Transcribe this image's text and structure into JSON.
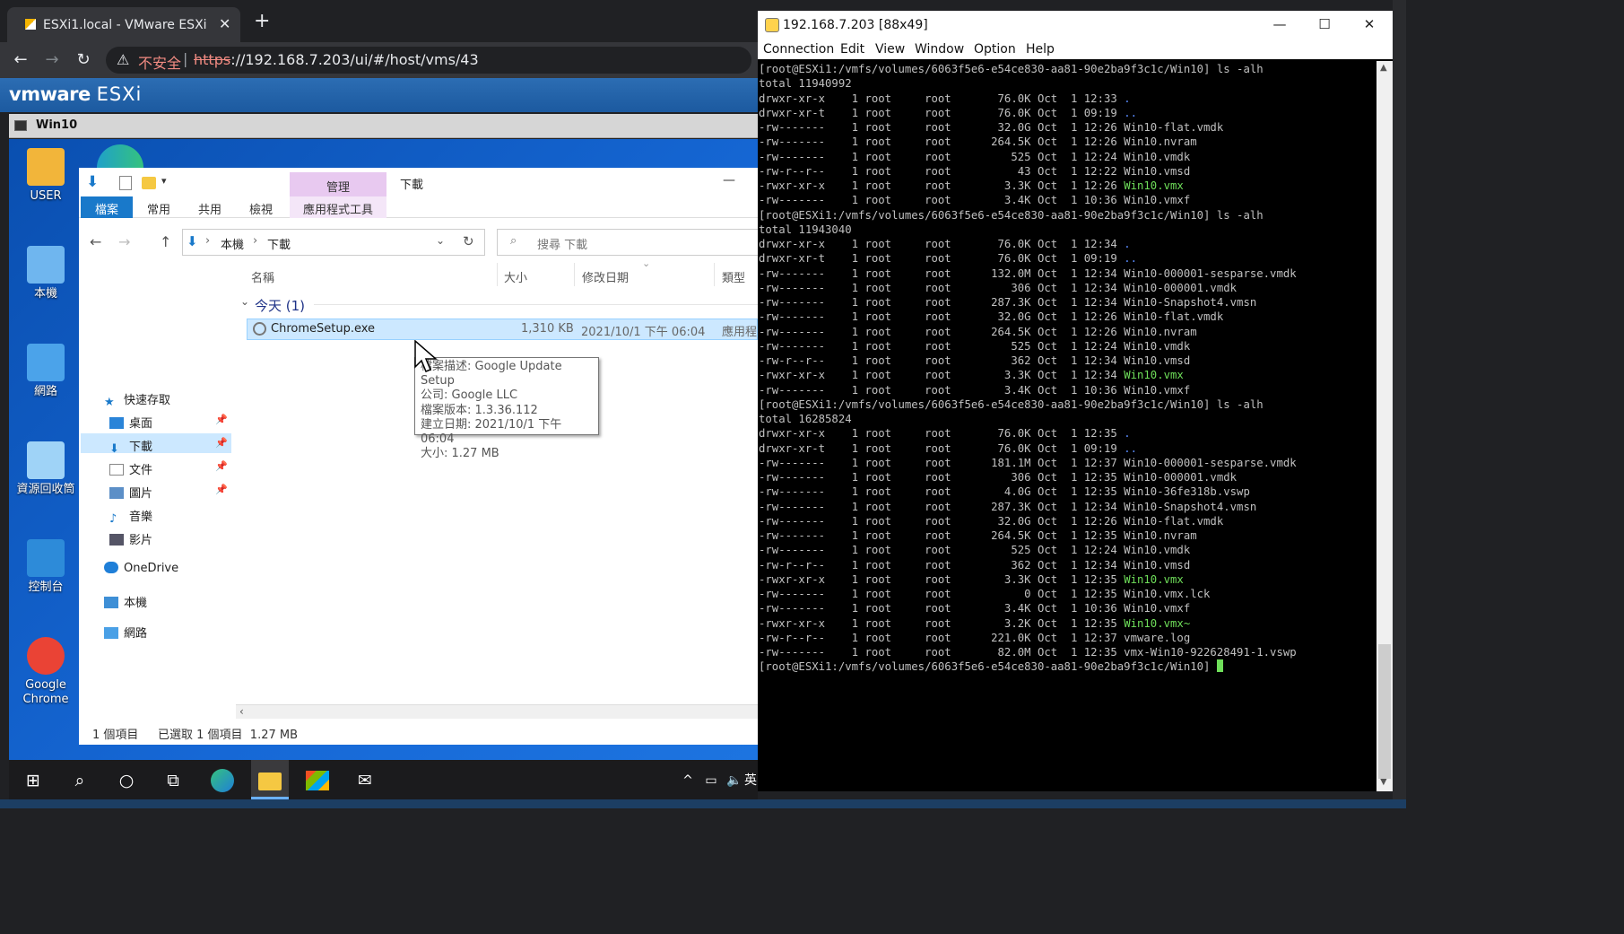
{
  "browser": {
    "tab_title": "ESXi1.local - VMware ESXi",
    "tab_close": "✕",
    "new_tab": "+",
    "insecure_label": "不安全",
    "url_scheme": "https",
    "url_rest": "://192.168.7.203/ui/#/host/vms/43"
  },
  "esxi": {
    "logo_vm": "vmware",
    "logo_product": "ESXi",
    "vm_name": "Win10"
  },
  "desktop": {
    "icons": [
      {
        "label": "USER",
        "color": "#f2b53a"
      },
      {
        "label": "本機",
        "color": "#6fb6ef"
      },
      {
        "label": "網路",
        "color": "#4ba3ea"
      },
      {
        "label": "資源回收筒",
        "color": "#9fd3f7"
      },
      {
        "label": "控制台",
        "color": "#2d8bd9"
      },
      {
        "label": "Google\nChrome",
        "color": "#ea4335"
      }
    ]
  },
  "explorer": {
    "window_title": "下載",
    "minimize": "—",
    "context_tab": "管理",
    "ribbon_tabs": [
      "檔案",
      "常用",
      "共用",
      "檢視"
    ],
    "context_sub": "應用程式工具",
    "breadcrumb": [
      "本機",
      "下載"
    ],
    "search_placeholder": "搜尋 下載",
    "columns": [
      "名稱",
      "大小",
      "修改日期",
      "類型"
    ],
    "nav": {
      "quick_access": "快速存取",
      "items": [
        "桌面",
        "下載",
        "文件",
        "圖片",
        "音樂",
        "影片"
      ],
      "onedrive": "OneDrive",
      "this_pc": "本機",
      "network": "網路"
    },
    "group_header": "今天 (1)",
    "file": {
      "name": "ChromeSetup.exe",
      "size": "1,310 KB",
      "modified": "2021/10/1 下午 06:04",
      "type": "應用程"
    },
    "tooltip": [
      "檔案描述: Google Update Setup",
      "公司: Google LLC",
      "檔案版本: 1.3.36.112",
      "建立日期: 2021/10/1 下午 06:04",
      "大小: 1.27 MB"
    ],
    "status_count": "1 個項目",
    "status_selected": "已選取 1 個項目  1.27 MB"
  },
  "taskbar": {
    "tray_text": "英"
  },
  "putty": {
    "title": "192.168.7.203 [88x49]",
    "menu": [
      "Connection",
      "Edit",
      "View",
      "Window",
      "Option",
      "Help"
    ]
  },
  "terminal_lines": [
    [
      [
        "[root@ESXi1:/vmfs/volumes/6063f5e6-e54ce830-aa81-90e2ba9f3c1c/Win10] ls -alh",
        ""
      ]
    ],
    [
      [
        "total 11940992",
        ""
      ]
    ],
    [
      [
        "drwxr-xr-x    1 root     root       76.0K Oct  1 12:33 ",
        ""
      ],
      [
        ".",
        "b"
      ]
    ],
    [
      [
        "drwxr-xr-t    1 root     root       76.0K Oct  1 09:19 ",
        ""
      ],
      [
        "..",
        "b"
      ]
    ],
    [
      [
        "-rw-------    1 root     root       32.0G Oct  1 12:26 Win10-flat.vmdk",
        ""
      ]
    ],
    [
      [
        "-rw-------    1 root     root      264.5K Oct  1 12:26 Win10.nvram",
        ""
      ]
    ],
    [
      [
        "-rw-------    1 root     root         525 Oct  1 12:24 Win10.vmdk",
        ""
      ]
    ],
    [
      [
        "-rw-r--r--    1 root     root          43 Oct  1 12:22 Win10.vmsd",
        ""
      ]
    ],
    [
      [
        "-rwxr-xr-x    1 root     root        3.3K Oct  1 12:26 ",
        ""
      ],
      [
        "Win10.vmx",
        "g"
      ]
    ],
    [
      [
        "-rw-------    1 root     root        3.4K Oct  1 10:36 Win10.vmxf",
        ""
      ]
    ],
    [
      [
        "[root@ESXi1:/vmfs/volumes/6063f5e6-e54ce830-aa81-90e2ba9f3c1c/Win10] ls -alh",
        ""
      ]
    ],
    [
      [
        "total 11943040",
        ""
      ]
    ],
    [
      [
        "drwxr-xr-x    1 root     root       76.0K Oct  1 12:34 ",
        ""
      ],
      [
        ".",
        "b"
      ]
    ],
    [
      [
        "drwxr-xr-t    1 root     root       76.0K Oct  1 09:19 ",
        ""
      ],
      [
        "..",
        "b"
      ]
    ],
    [
      [
        "-rw-------    1 root     root      132.0M Oct  1 12:34 Win10-000001-sesparse.vmdk",
        ""
      ]
    ],
    [
      [
        "-rw-------    1 root     root         306 Oct  1 12:34 Win10-000001.vmdk",
        ""
      ]
    ],
    [
      [
        "-rw-------    1 root     root      287.3K Oct  1 12:34 Win10-Snapshot4.vmsn",
        ""
      ]
    ],
    [
      [
        "-rw-------    1 root     root       32.0G Oct  1 12:26 Win10-flat.vmdk",
        ""
      ]
    ],
    [
      [
        "-rw-------    1 root     root      264.5K Oct  1 12:26 Win10.nvram",
        ""
      ]
    ],
    [
      [
        "-rw-------    1 root     root         525 Oct  1 12:24 Win10.vmdk",
        ""
      ]
    ],
    [
      [
        "-rw-r--r--    1 root     root         362 Oct  1 12:34 Win10.vmsd",
        ""
      ]
    ],
    [
      [
        "-rwxr-xr-x    1 root     root        3.3K Oct  1 12:34 ",
        ""
      ],
      [
        "Win10.vmx",
        "g"
      ]
    ],
    [
      [
        "-rw-------    1 root     root        3.4K Oct  1 10:36 Win10.vmxf",
        ""
      ]
    ],
    [
      [
        "[root@ESXi1:/vmfs/volumes/6063f5e6-e54ce830-aa81-90e2ba9f3c1c/Win10] ls -alh",
        ""
      ]
    ],
    [
      [
        "total 16285824",
        ""
      ]
    ],
    [
      [
        "drwxr-xr-x    1 root     root       76.0K Oct  1 12:35 ",
        ""
      ],
      [
        ".",
        "b"
      ]
    ],
    [
      [
        "drwxr-xr-t    1 root     root       76.0K Oct  1 09:19 ",
        ""
      ],
      [
        "..",
        "b"
      ]
    ],
    [
      [
        "-rw-------    1 root     root      181.1M Oct  1 12:37 Win10-000001-sesparse.vmdk",
        ""
      ]
    ],
    [
      [
        "-rw-------    1 root     root         306 Oct  1 12:35 Win10-000001.vmdk",
        ""
      ]
    ],
    [
      [
        "-rw-------    1 root     root        4.0G Oct  1 12:35 Win10-36fe318b.vswp",
        ""
      ]
    ],
    [
      [
        "-rw-------    1 root     root      287.3K Oct  1 12:34 Win10-Snapshot4.vmsn",
        ""
      ]
    ],
    [
      [
        "-rw-------    1 root     root       32.0G Oct  1 12:26 Win10-flat.vmdk",
        ""
      ]
    ],
    [
      [
        "-rw-------    1 root     root      264.5K Oct  1 12:35 Win10.nvram",
        ""
      ]
    ],
    [
      [
        "-rw-------    1 root     root         525 Oct  1 12:24 Win10.vmdk",
        ""
      ]
    ],
    [
      [
        "-rw-r--r--    1 root     root         362 Oct  1 12:34 Win10.vmsd",
        ""
      ]
    ],
    [
      [
        "-rwxr-xr-x    1 root     root        3.3K Oct  1 12:35 ",
        ""
      ],
      [
        "Win10.vmx",
        "g"
      ]
    ],
    [
      [
        "-rw-------    1 root     root           0 Oct  1 12:35 Win10.vmx.lck",
        ""
      ]
    ],
    [
      [
        "-rw-------    1 root     root        3.4K Oct  1 10:36 Win10.vmxf",
        ""
      ]
    ],
    [
      [
        "-rwxr-xr-x    1 root     root        3.2K Oct  1 12:35 ",
        ""
      ],
      [
        "Win10.vmx~",
        "g"
      ]
    ],
    [
      [
        "-rw-r--r--    1 root     root      221.0K Oct  1 12:37 vmware.log",
        ""
      ]
    ],
    [
      [
        "-rw-------    1 root     root       82.0M Oct  1 12:35 vmx-Win10-922628491-1.vswp",
        ""
      ]
    ],
    [
      [
        "[root@ESXi1:/vmfs/volumes/6063f5e6-e54ce830-aa81-90e2ba9f3c1c/Win10] ",
        ""
      ]
    ]
  ]
}
